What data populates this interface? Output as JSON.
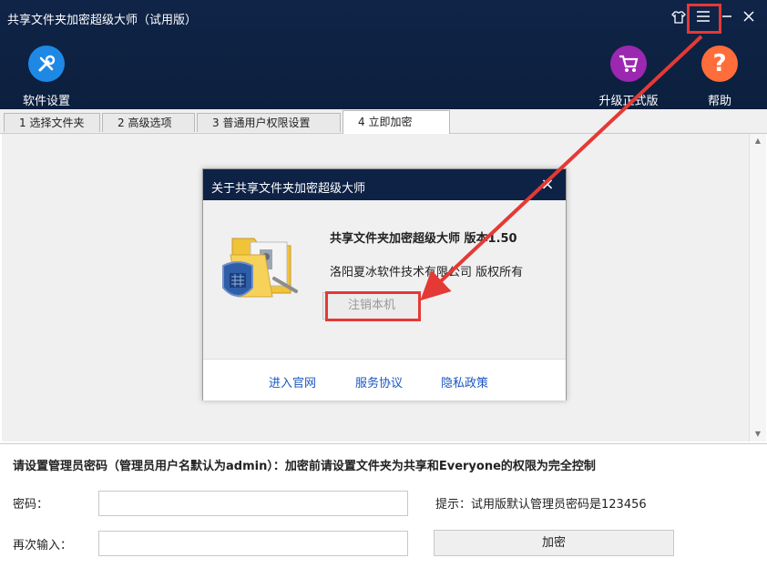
{
  "window": {
    "title": "共享文件夹加密超级大师（试用版）"
  },
  "toolbar": {
    "settings_label": "软件设置",
    "upgrade_label": "升级正式版",
    "help_label": "帮助"
  },
  "tabs": [
    {
      "label": "1 选择文件夹"
    },
    {
      "label": "2 高级选项"
    },
    {
      "label": "3 普通用户权限设置"
    },
    {
      "label": "4 立即加密"
    }
  ],
  "about_dialog": {
    "title": "关于共享文件夹加密超级大师",
    "product": "共享文件夹加密超级大师 版本1.50",
    "copyright": "洛阳夏冰软件技术有限公司 版权所有",
    "unregister_label": "注销本机",
    "links": [
      "进入官网",
      "服务协议",
      "隐私政策"
    ]
  },
  "form": {
    "notice": "请设置管理员密码（管理员用户名默认为admin）：加密前请设置文件夹为共享和Everyone的权限为完全控制",
    "password_label": "密码：",
    "confirm_label": "再次输入：",
    "hint": "提示：试用版默认管理员密码是123456",
    "encrypt_label": "加密",
    "password_value": "",
    "confirm_value": ""
  },
  "colors": {
    "header_bg": "#0f2447",
    "highlight": "#e53935",
    "settings_icon": "#1e88e5",
    "upgrade_icon": "#9c27b0",
    "help_icon": "#ff6d3a",
    "link": "#1a56c2"
  }
}
